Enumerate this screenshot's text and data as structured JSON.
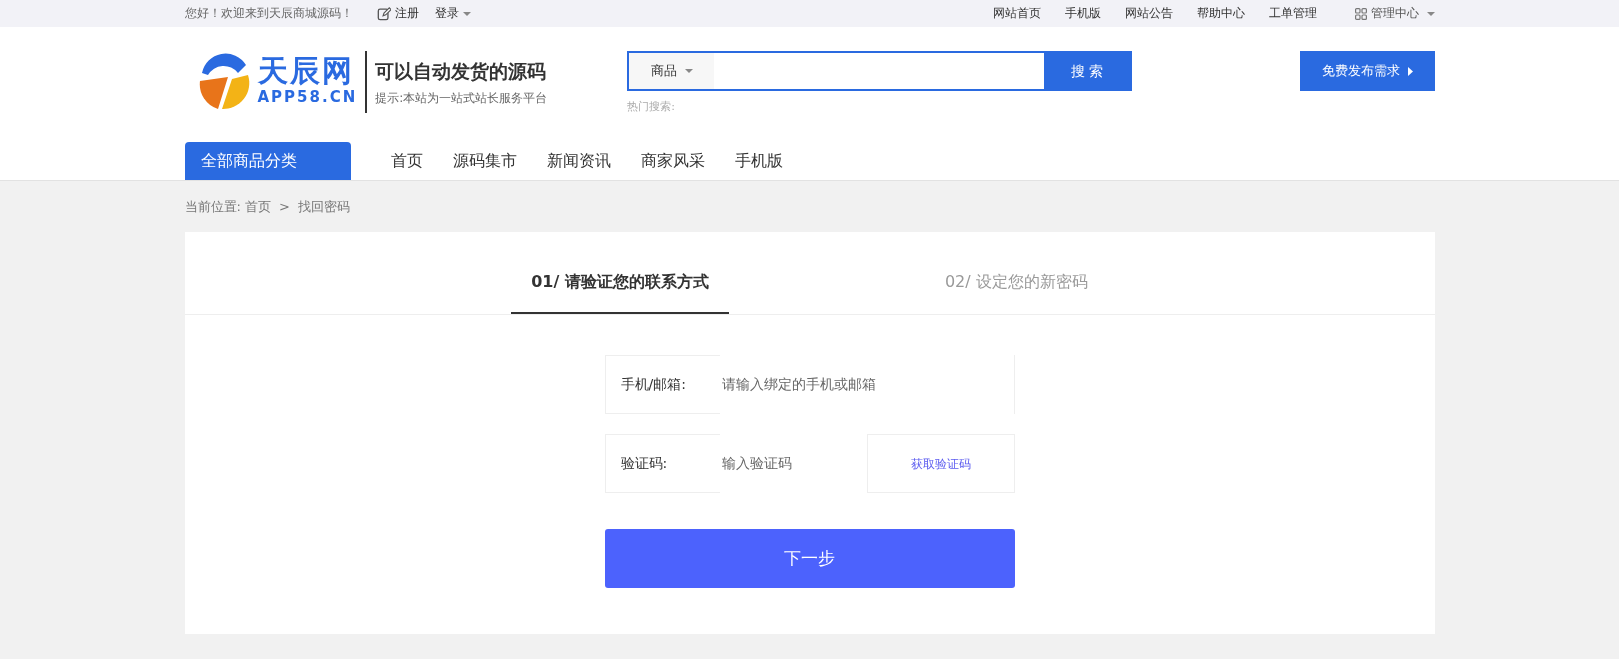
{
  "topbar": {
    "welcome": "您好！欢迎来到天辰商城源码！",
    "register": "注册",
    "login": "登录",
    "links": [
      "网站首页",
      "手机版",
      "网站公告",
      "帮助中心",
      "工单管理"
    ],
    "admin": "管理中心"
  },
  "header": {
    "logo_title": "天辰网",
    "logo_domain": "APP58.CN",
    "slogan": "可以自动发货的源码",
    "tip": "提示:本站为一站式站长服务平台",
    "search": {
      "category": "商品",
      "button": "搜 索"
    },
    "hot_label": "热门搜索:",
    "publish_button": "免费发布需求"
  },
  "nav": {
    "category_button": "全部商品分类",
    "items": [
      "首页",
      "源码集市",
      "新闻资讯",
      "商家风采",
      "手机版"
    ]
  },
  "breadcrumb": {
    "label": "当前位置:",
    "items": [
      "首页",
      "找回密码"
    ],
    "separator": ">"
  },
  "steps": [
    {
      "label": "01/ 请验证您的联系方式",
      "selected": true
    },
    {
      "label": "02/ 设定您的新密码",
      "selected": false
    }
  ],
  "form": {
    "fields": [
      {
        "kind": "plain",
        "label": "手机/邮箱:",
        "placeholder": "请输入绑定的手机或邮箱"
      },
      {
        "kind": "code",
        "label": "验证码:",
        "placeholder": "输入验证码",
        "action": "获取验证码"
      }
    ],
    "submit": "下一步"
  }
}
